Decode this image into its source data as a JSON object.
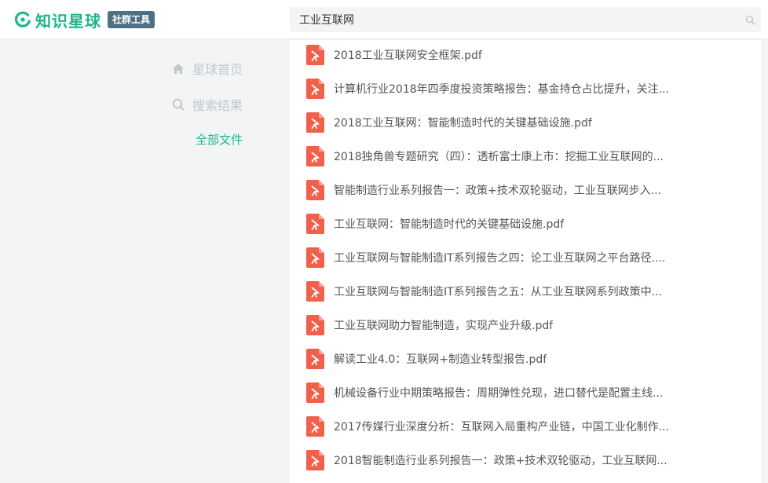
{
  "header": {
    "logo_text": "知识星球",
    "badge": "社群工具",
    "search_value": "工业互联网"
  },
  "sidebar": {
    "items": [
      {
        "label": "星球首页",
        "icon": "home-icon"
      },
      {
        "label": "搜索结果",
        "icon": "search-icon"
      },
      {
        "label": "全部文件",
        "icon": ""
      }
    ]
  },
  "files": [
    "2018工业互联网安全框架.pdf",
    "计算机行业2018年四季度投资策略报告：基金持仓占比提升，关注...",
    "2018工业互联网：智能制造时代的关键基础设施.pdf",
    "2018独角兽专题研究（四）：透析富士康上市：挖掘工业互联网的...",
    "智能制造行业系列报告一：政策+技术双轮驱动，工业互联网步入...",
    "工业互联网：智能制造时代的关键基础设施.pdf",
    "工业互联网与智能制造IT系列报告之四：论工业互联网之平台路径....",
    "工业互联网与智能制造IT系列报告之五：从工业互联网系列政策中...",
    "工业互联网助力智能制造，实现产业升级.pdf",
    "解读工业4.0：互联网+制造业转型报告.pdf",
    "机械设备行业中期策略报告：周期弹性兑现，进口替代是配置主线...",
    "2017传媒行业深度分析：互联网入局重构产业链，中国工业化制作...",
    "2018智能制造行业系列报告一：政策+技术双轮驱动，工业互联网..."
  ],
  "colors": {
    "brand": "#1fb58a",
    "badge": "#4f6f86",
    "pdf": "#f0604a"
  }
}
